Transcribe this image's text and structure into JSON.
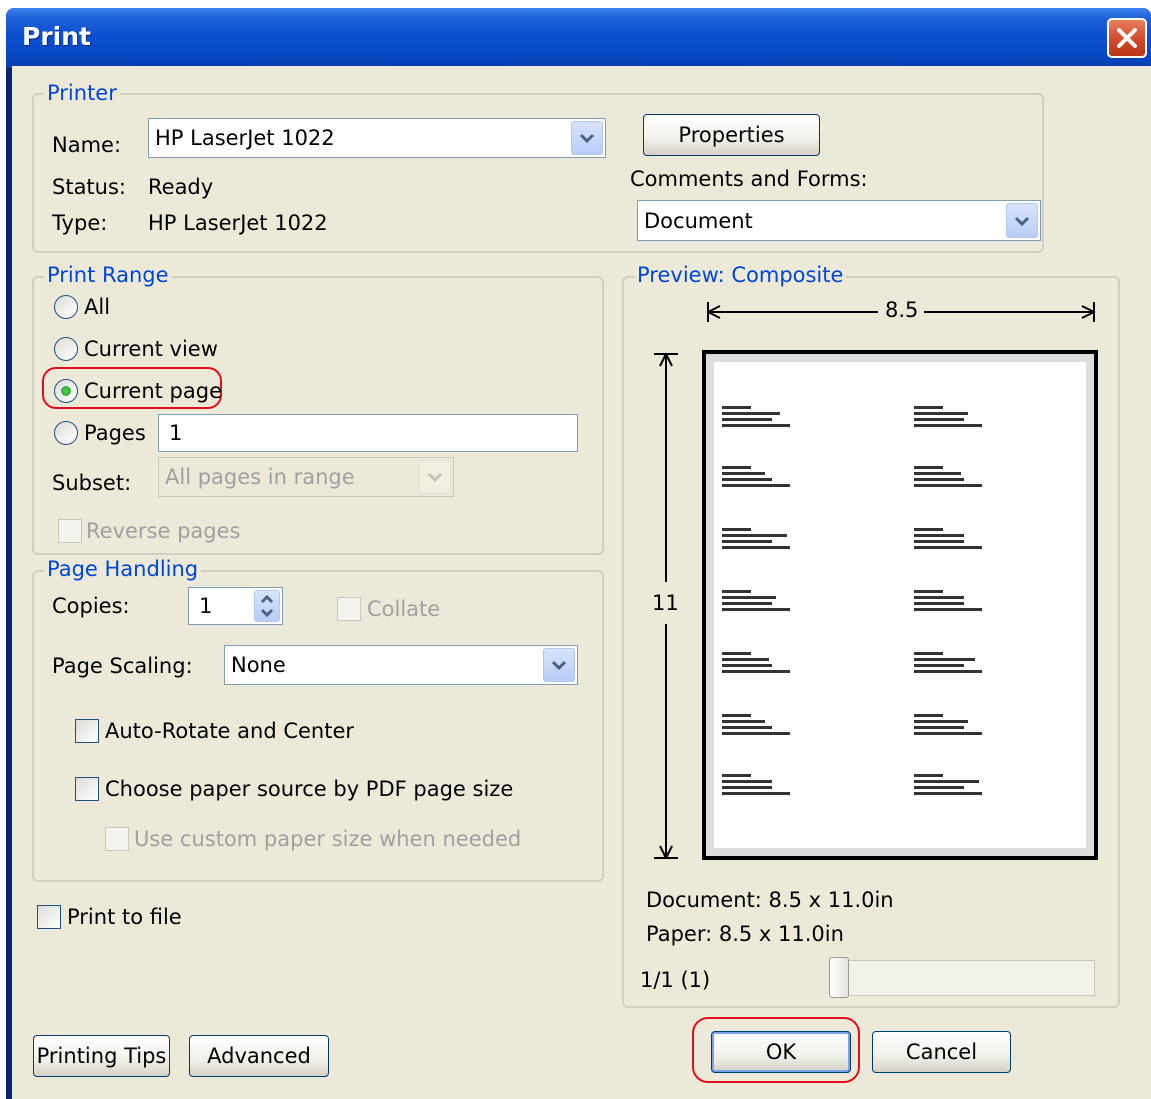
{
  "dialog": {
    "title": "Print"
  },
  "printer": {
    "legend": "Printer",
    "name_label": "Name:",
    "name_value": "HP LaserJet 1022",
    "status_label": "Status:",
    "status_value": "Ready",
    "type_label": "Type:",
    "type_value": "HP LaserJet 1022",
    "properties_button": "Properties",
    "comments_label": "Comments and Forms:",
    "comments_value": "Document"
  },
  "print_range": {
    "legend": "Print Range",
    "all": "All",
    "current_view": "Current view",
    "current_page": "Current page",
    "selected": "current_page",
    "pages_label": "Pages",
    "pages_value": "1",
    "subset_label": "Subset:",
    "subset_value": "All pages in range",
    "reverse_pages": "Reverse pages"
  },
  "page_handling": {
    "legend": "Page Handling",
    "copies_label": "Copies:",
    "copies_value": "1",
    "collate": "Collate",
    "scaling_label": "Page Scaling:",
    "scaling_value": "None",
    "auto_rotate": "Auto-Rotate and Center",
    "paper_source": "Choose paper source by PDF page size",
    "custom_paper": "Use custom paper size when needed"
  },
  "print_to_file": "Print to file",
  "preview": {
    "legend": "Preview: Composite",
    "width_label": "8.5",
    "height_label": "11",
    "document_size": "Document: 8.5 x 11.0in",
    "paper_size": "Paper: 8.5 x 11.0in",
    "page_counter": "1/1 (1)"
  },
  "buttons": {
    "printing_tips": "Printing Tips",
    "advanced": "Advanced",
    "ok": "OK",
    "cancel": "Cancel"
  },
  "colors": {
    "titlebar": "#0a4fd0",
    "legend": "#0046d5",
    "face": "#ece9d8",
    "highlight": "#e0101a"
  },
  "icons": {
    "close": "close-icon",
    "dropdown": "chevron-down-icon",
    "spinner": "spinner-arrows-icon"
  }
}
